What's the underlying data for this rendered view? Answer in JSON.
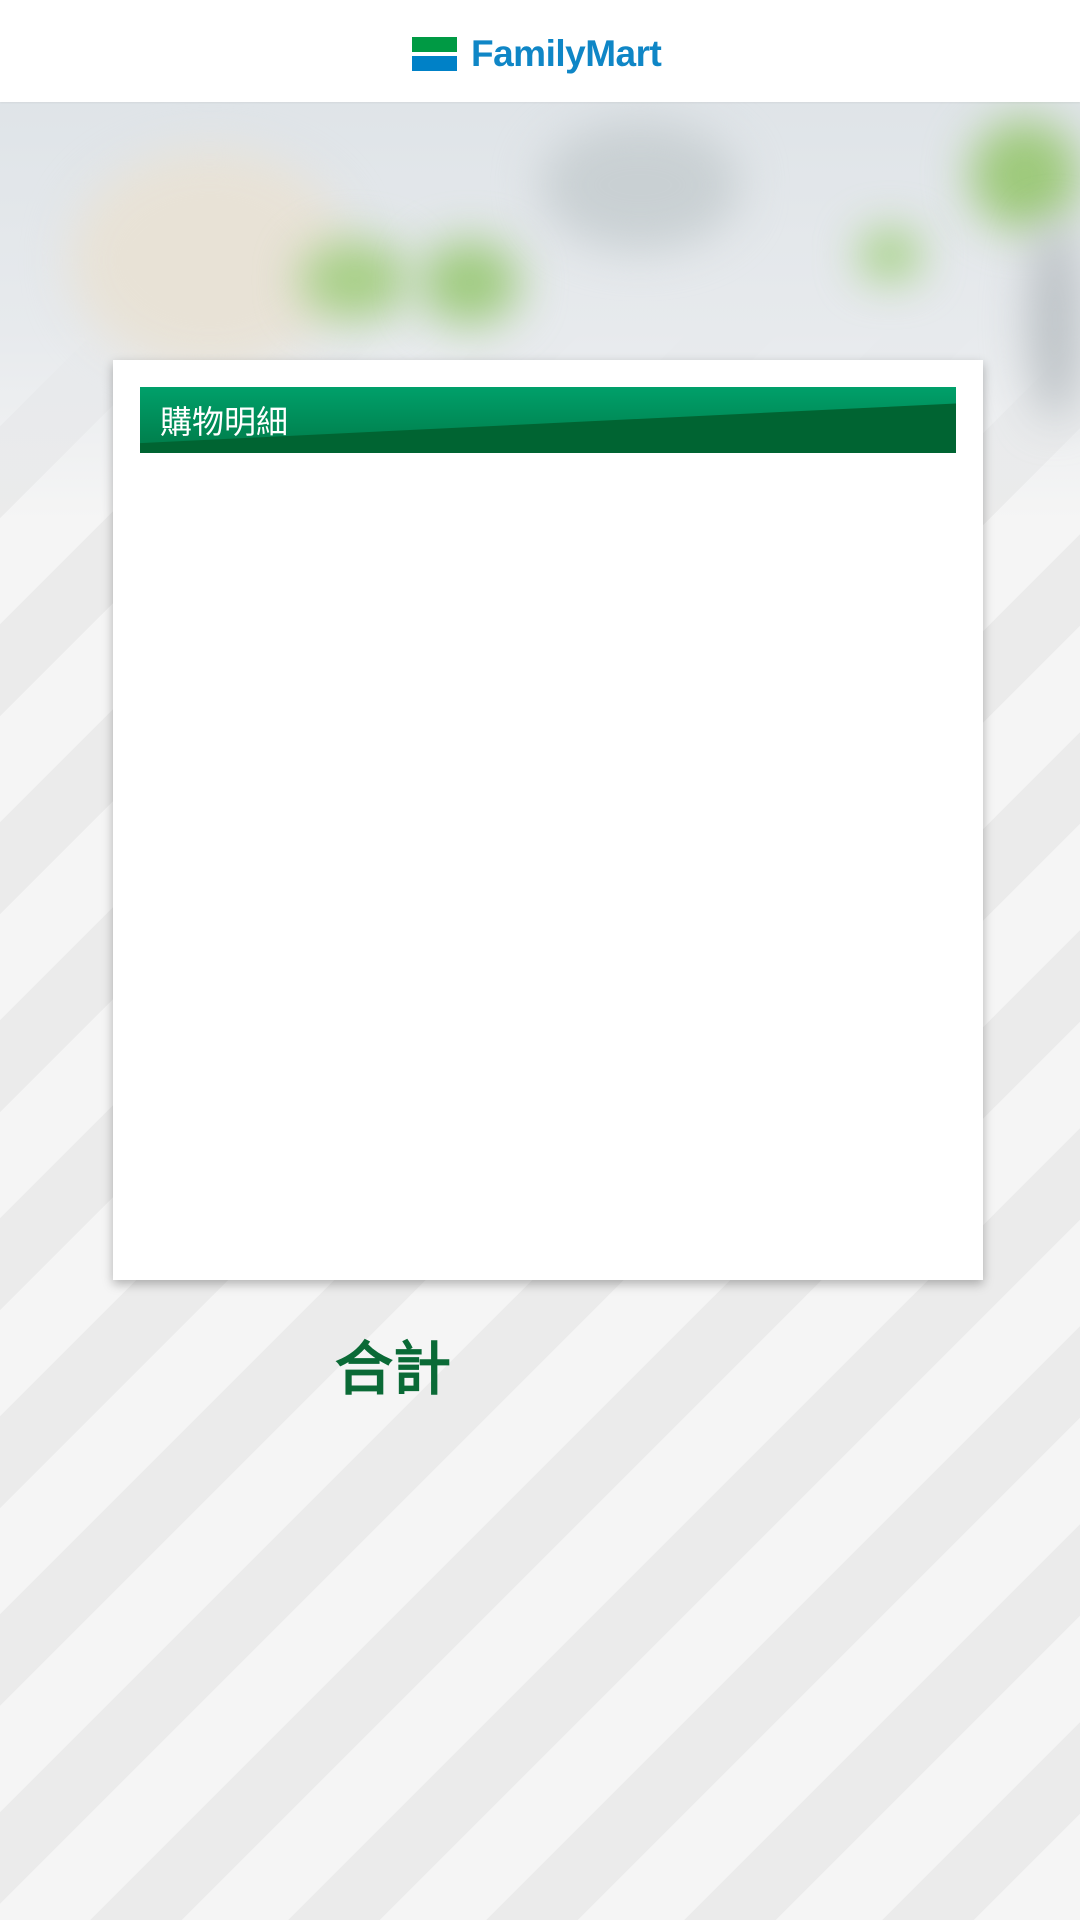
{
  "header": {
    "logo_text": "FamilyMart",
    "logo_icon": "familymart-stripes-icon"
  },
  "card": {
    "title": "購物明細",
    "items": []
  },
  "summary": {
    "total_label": "合計"
  },
  "colors": {
    "brand_green": "#009a44",
    "brand_blue": "#0081c7",
    "header_green": "#007a48",
    "total_text": "#0a6a36"
  }
}
